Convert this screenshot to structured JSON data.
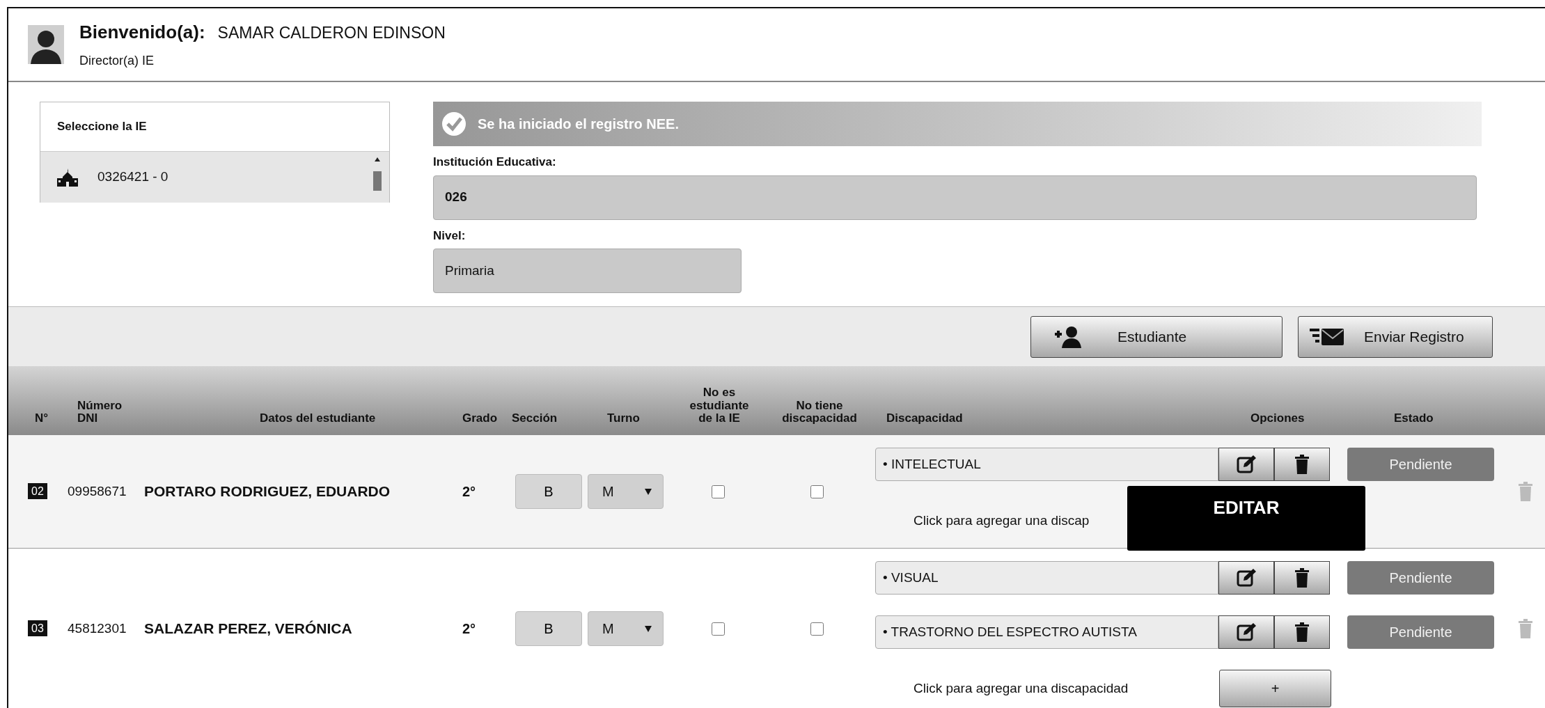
{
  "user": {
    "greeting": "Bienvenido(a):",
    "name": "SAMAR CALDERON EDINSON",
    "role": "Director(a) IE"
  },
  "ie_list": {
    "title": "Seleccione la IE",
    "items": [
      {
        "code": "0326421 - 0",
        "selected": true
      }
    ]
  },
  "alert": {
    "message": "Se ha iniciado el registro NEE."
  },
  "fields": [
    {
      "label": "Institución Educativa:",
      "value": "026"
    },
    {
      "label": "Nivel:",
      "value": "Primaria"
    }
  ],
  "toolbar": {
    "buttons": [
      {
        "label": "Estudiante",
        "kind": "add-student"
      },
      {
        "label": "Enviar Registro",
        "kind": "send"
      }
    ]
  },
  "table": {
    "columns": [
      "N°",
      "Número DNI",
      "Datos del estudiante",
      "Grado",
      "Sección",
      "Turno",
      "No es estudiante de la IE",
      "No tiene discapacidad",
      "Discapacidad",
      "Opciones",
      "Estado"
    ],
    "rows": [
      {
        "number": "02",
        "dni": "09958671",
        "name": "PORTARO RODRIGUEZ, EDUARDO",
        "grade": "2°",
        "section": "B",
        "shift": "M",
        "not_student": false,
        "no_disability": false,
        "disabilities": [
          {
            "name": "• INTELECTUAL",
            "status": "Pendiente",
            "tooltip": "EDITAR"
          }
        ],
        "add_text": "Click para agregar una discap"
      },
      {
        "number": "03",
        "dni": "45812301",
        "name": "SALAZAR PEREZ, VERÓNICA",
        "grade": "2°",
        "section": "B",
        "shift": "M",
        "not_student": false,
        "no_disability": false,
        "disabilities": [
          {
            "name": "• VISUAL",
            "status": "Pendiente"
          },
          {
            "name": "• TRASTORNO DEL ESPECTRO AUTISTA",
            "status": "Pendiente"
          }
        ],
        "add_text": "Click para agregar una discapacidad",
        "add_button": "+"
      }
    ]
  }
}
